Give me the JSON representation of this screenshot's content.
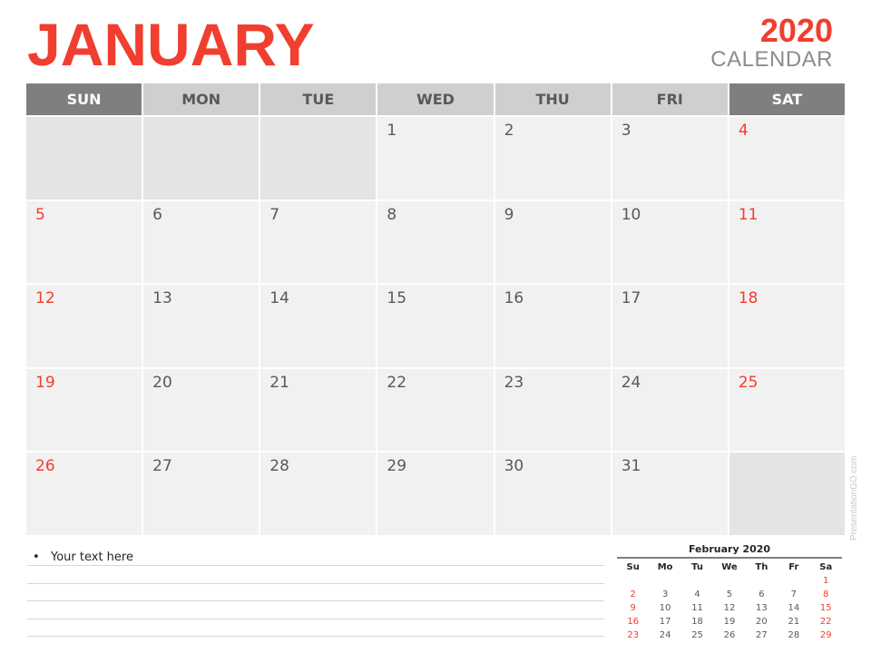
{
  "header": {
    "month": "JANUARY",
    "year": "2020",
    "subtitle": "CALENDAR"
  },
  "colors": {
    "accent": "#f03e2f",
    "weekend_header": "#7f7f7f",
    "weekday_header": "#d0cecf",
    "cell": "#f1f1f1",
    "empty_cell": "#e4e4e4",
    "text": "#595959"
  },
  "weekdays": [
    "SUN",
    "MON",
    "TUE",
    "WED",
    "THU",
    "FRI",
    "SAT"
  ],
  "weeks": [
    [
      "",
      "",
      "",
      "1",
      "2",
      "3",
      "4"
    ],
    [
      "5",
      "6",
      "7",
      "8",
      "9",
      "10",
      "11"
    ],
    [
      "12",
      "13",
      "14",
      "15",
      "16",
      "17",
      "18"
    ],
    [
      "19",
      "20",
      "21",
      "22",
      "23",
      "24",
      "25"
    ],
    [
      "26",
      "27",
      "28",
      "29",
      "30",
      "31",
      ""
    ]
  ],
  "notes": {
    "bullet": "•",
    "text": "Your text here"
  },
  "mini_calendar": {
    "title": "February 2020",
    "weekdays": [
      "Su",
      "Mo",
      "Tu",
      "We",
      "Th",
      "Fr",
      "Sa"
    ],
    "weeks": [
      [
        "",
        "",
        "",
        "",
        "",
        "",
        "1"
      ],
      [
        "2",
        "3",
        "4",
        "5",
        "6",
        "7",
        "8"
      ],
      [
        "9",
        "10",
        "11",
        "12",
        "13",
        "14",
        "15"
      ],
      [
        "16",
        "17",
        "18",
        "19",
        "20",
        "21",
        "22"
      ],
      [
        "23",
        "24",
        "25",
        "26",
        "27",
        "28",
        "29"
      ]
    ]
  },
  "watermark": "PresentationGO.com"
}
